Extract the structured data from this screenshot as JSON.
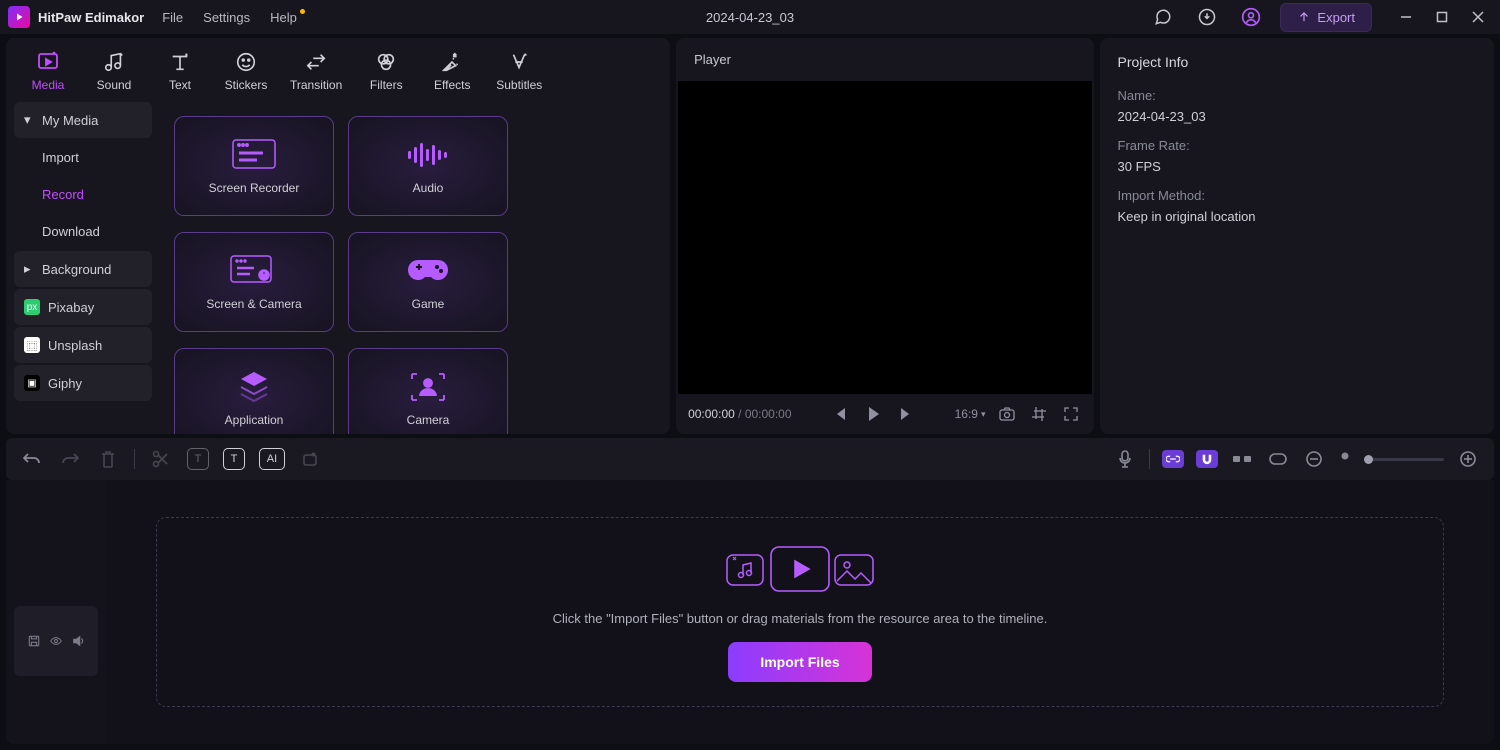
{
  "app": {
    "name": "HitPaw Edimakor"
  },
  "menu": {
    "file": "File",
    "settings": "Settings",
    "help": "Help"
  },
  "project_title": "2024-04-23_03",
  "export_label": "Export",
  "tool_tabs": [
    {
      "label": "Media",
      "active": true
    },
    {
      "label": "Sound"
    },
    {
      "label": "Text"
    },
    {
      "label": "Stickers"
    },
    {
      "label": "Transition"
    },
    {
      "label": "Filters"
    },
    {
      "label": "Effects"
    },
    {
      "label": "Subtitles"
    }
  ],
  "sidebar": {
    "my_media": "My Media",
    "import": "Import",
    "record": "Record",
    "download": "Download",
    "background": "Background",
    "pixabay": "Pixabay",
    "unsplash": "Unsplash",
    "giphy": "Giphy"
  },
  "cards": {
    "screen_recorder": "Screen Recorder",
    "audio": "Audio",
    "screen_camera": "Screen & Camera",
    "game": "Game",
    "application": "Application",
    "camera": "Camera"
  },
  "player": {
    "title": "Player",
    "current": "00:00:00",
    "total": "00:00:00",
    "ratio": "16:9"
  },
  "project_info": {
    "title": "Project Info",
    "name_label": "Name:",
    "name_value": "2024-04-23_03",
    "fps_label": "Frame Rate:",
    "fps_value": "30 FPS",
    "import_label": "Import Method:",
    "import_value": "Keep in original location"
  },
  "timeline": {
    "hint": "Click the \"Import Files\" button or drag materials from the resource area to the timeline.",
    "import_btn": "Import Files"
  }
}
